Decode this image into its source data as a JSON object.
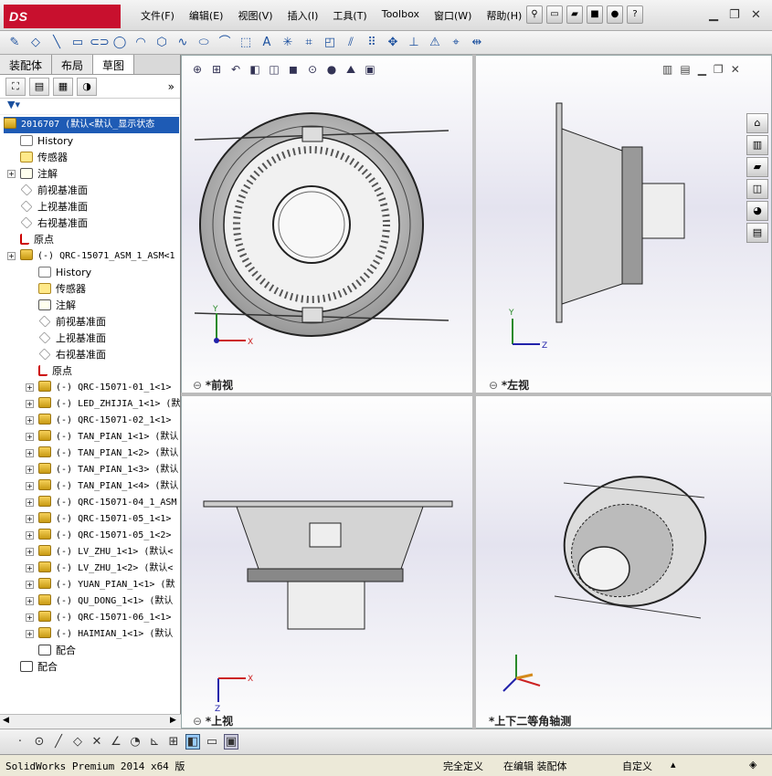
{
  "app": {
    "logo": "DS SOLIDWORKS"
  },
  "menu": [
    "文件(F)",
    "编辑(E)",
    "视图(V)",
    "插入(I)",
    "工具(T)",
    "Toolbox",
    "窗口(W)",
    "帮助(H)"
  ],
  "tabs": [
    "装配体",
    "布局",
    "草图"
  ],
  "tree": {
    "root": "2016707 (默认<默认_显示状态",
    "items": [
      {
        "label": "History",
        "icon": "history-icon",
        "indent": 1
      },
      {
        "label": "传感器",
        "icon": "sensor-icon",
        "indent": 1
      },
      {
        "label": "注解",
        "icon": "annotation-icon",
        "indent": 1,
        "expand": true
      },
      {
        "label": "前视基准面",
        "icon": "plane-icon",
        "indent": 1
      },
      {
        "label": "上视基准面",
        "icon": "plane-icon",
        "indent": 1
      },
      {
        "label": "右视基准面",
        "icon": "plane-icon",
        "indent": 1
      },
      {
        "label": "原点",
        "icon": "origin-icon",
        "indent": 1
      },
      {
        "label": "(-) QRC-15071_ASM_1_ASM<1",
        "icon": "component-icon",
        "indent": 1,
        "expand": true,
        "mono": true
      },
      {
        "label": "History",
        "icon": "history-icon",
        "indent": 2
      },
      {
        "label": "传感器",
        "icon": "sensor-icon",
        "indent": 2
      },
      {
        "label": "注解",
        "icon": "annotation-icon",
        "indent": 2
      },
      {
        "label": "前视基准面",
        "icon": "plane-icon",
        "indent": 2
      },
      {
        "label": "上视基准面",
        "icon": "plane-icon",
        "indent": 2
      },
      {
        "label": "右视基准面",
        "icon": "plane-icon",
        "indent": 2
      },
      {
        "label": "原点",
        "icon": "origin-icon",
        "indent": 2
      },
      {
        "label": "(-) QRC-15071-01_1<1>",
        "icon": "component-icon",
        "indent": 2,
        "expand": true,
        "mono": true
      },
      {
        "label": "(-) LED_ZHIJIA_1<1> (默",
        "icon": "component-icon",
        "indent": 2,
        "expand": true,
        "mono": true
      },
      {
        "label": "(-) QRC-15071-02_1<1>",
        "icon": "component-icon",
        "indent": 2,
        "expand": true,
        "mono": true
      },
      {
        "label": "(-) TAN_PIAN_1<1> (默认",
        "icon": "component-icon",
        "indent": 2,
        "expand": true,
        "mono": true
      },
      {
        "label": "(-) TAN_PIAN_1<2> (默认",
        "icon": "component-icon",
        "indent": 2,
        "expand": true,
        "mono": true
      },
      {
        "label": "(-) TAN_PIAN_1<3> (默认",
        "icon": "component-icon",
        "indent": 2,
        "expand": true,
        "mono": true
      },
      {
        "label": "(-) TAN_PIAN_1<4> (默认",
        "icon": "component-icon",
        "indent": 2,
        "expand": true,
        "mono": true
      },
      {
        "label": "(-) QRC-15071-04_1_ASM",
        "icon": "component-icon",
        "indent": 2,
        "expand": true,
        "mono": true
      },
      {
        "label": "(-) QRC-15071-05_1<1>",
        "icon": "component-icon",
        "indent": 2,
        "expand": true,
        "mono": true
      },
      {
        "label": "(-) QRC-15071-05_1<2>",
        "icon": "component-icon",
        "indent": 2,
        "expand": true,
        "mono": true
      },
      {
        "label": "(-) LV_ZHU_1<1> (默认<",
        "icon": "component-icon",
        "indent": 2,
        "expand": true,
        "mono": true
      },
      {
        "label": "(-) LV_ZHU_1<2> (默认<",
        "icon": "component-icon",
        "indent": 2,
        "expand": true,
        "mono": true
      },
      {
        "label": "(-) YUAN_PIAN_1<1> (默",
        "icon": "component-icon",
        "indent": 2,
        "expand": true,
        "mono": true
      },
      {
        "label": "(-) QU_DONG_1<1> (默认",
        "icon": "component-icon",
        "indent": 2,
        "expand": true,
        "mono": true
      },
      {
        "label": "(-) QRC-15071-06_1<1>",
        "icon": "component-icon",
        "indent": 2,
        "expand": true,
        "mono": true
      },
      {
        "label": "(-) HAIMIAN_1<1> (默认",
        "icon": "component-icon",
        "indent": 2,
        "expand": true,
        "mono": true
      },
      {
        "label": "配合",
        "icon": "mate-icon",
        "indent": 2
      },
      {
        "label": "配合",
        "icon": "mate-icon",
        "indent": 1
      }
    ]
  },
  "views": {
    "front": "*前视",
    "left": "*左视",
    "top": "*上视",
    "iso": "*上下二等角轴测"
  },
  "status": {
    "version": "SolidWorks Premium 2014 x64 版",
    "defined": "完全定义",
    "editing": "在编辑 装配体",
    "units": "自定义"
  }
}
